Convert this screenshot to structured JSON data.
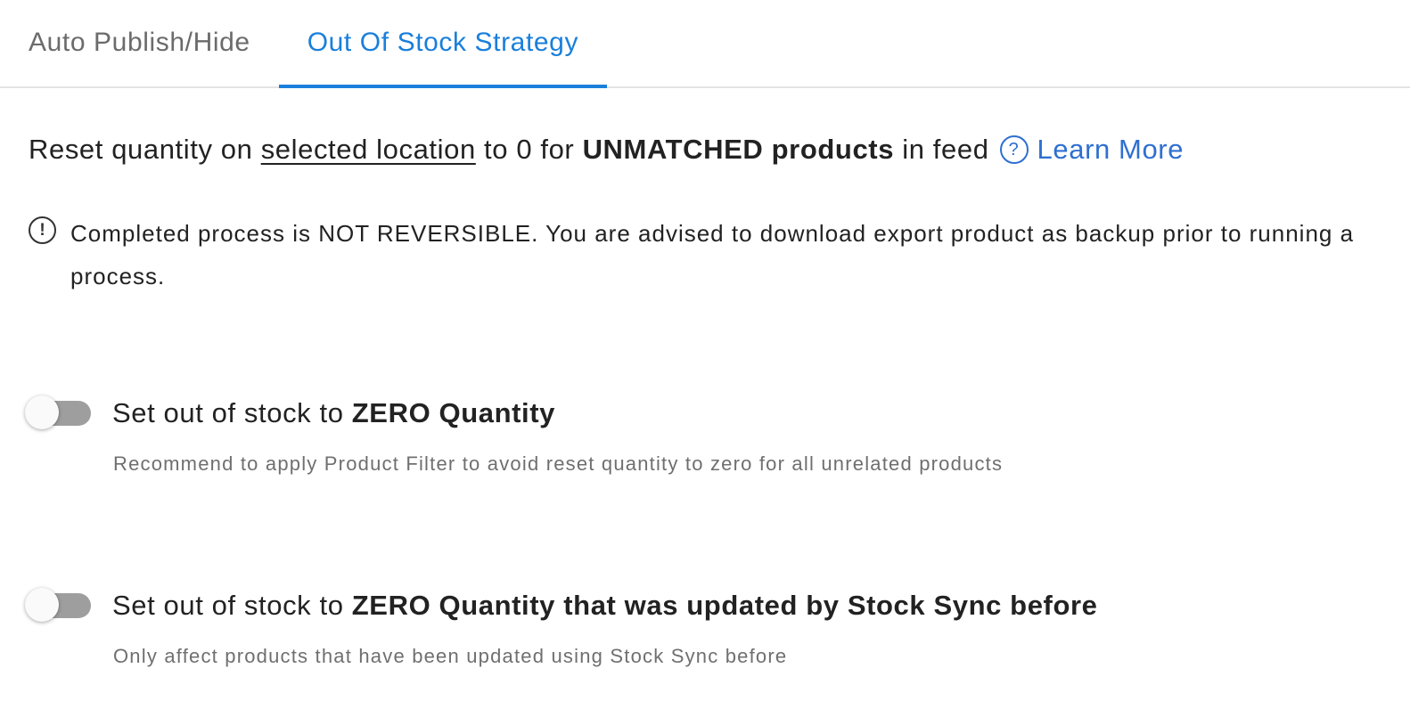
{
  "tabs": [
    {
      "label": "Auto Publish/Hide",
      "active": false
    },
    {
      "label": "Out Of Stock Strategy",
      "active": true
    }
  ],
  "headline": {
    "prefix": "Reset quantity on",
    "link": "selected location",
    "middle": "to 0 for",
    "bold": "UNMATCHED products",
    "suffix": "in feed",
    "help_icon": "?",
    "learn_more": "Learn More"
  },
  "warning": {
    "icon": "!",
    "text": "Completed process is NOT REVERSIBLE. You are advised to download export product as backup prior to running a process."
  },
  "options": [
    {
      "label_prefix": "Set out of stock to",
      "label_bold": "ZERO Quantity",
      "hint": "Recommend to apply Product Filter to avoid reset quantity to zero for all unrelated products",
      "enabled": false
    },
    {
      "label_prefix": "Set out of stock to",
      "label_bold": "ZERO Quantity that was updated by Stock Sync before",
      "hint": "Only affect products that have been updated using Stock Sync before",
      "enabled": false
    }
  ],
  "colors": {
    "accent": "#1a7fdb",
    "link": "#2f6fd0",
    "toggle_off": "#9e9e9e"
  }
}
